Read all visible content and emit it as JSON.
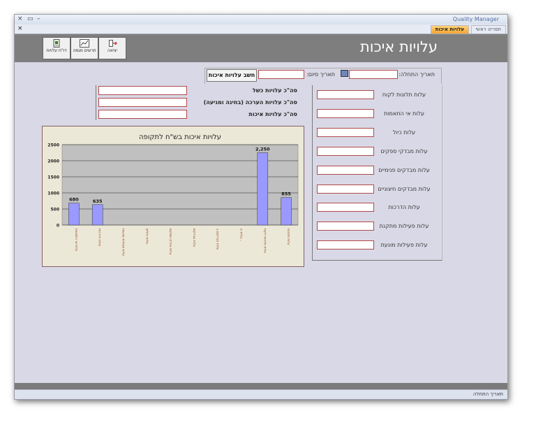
{
  "app": {
    "title": "Quality Manager",
    "window_controls": [
      "×",
      "▭",
      "–"
    ]
  },
  "tabs": [
    {
      "label": "עלויות איכות",
      "active": true
    },
    {
      "label": "תפריט ראשי",
      "active": false
    }
  ],
  "header": {
    "title": "עלויות איכות",
    "buttons": [
      {
        "label": "יציאה",
        "icon": "exit-icon"
      },
      {
        "label": "תרשים מגמה",
        "icon": "trend-chart-icon"
      },
      {
        "label": "דו\"ח עלויות",
        "icon": "report-icon"
      }
    ]
  },
  "filters": {
    "start_date_label": "תאריך התחלה:",
    "start_date_value": "",
    "end_date_label": "תאריך סיום:",
    "end_date_value": "",
    "calc_button": "חשב עלויות איכות"
  },
  "totals": [
    {
      "label": "סה\"כ עלויות כשל",
      "value": ""
    },
    {
      "label": "סה\"כ עלויות הערכה (בחינה ומניעה)",
      "value": ""
    },
    {
      "label": "סה\"כ עלויות איכות",
      "value": ""
    }
  ],
  "cost_fields": [
    {
      "label": "עלות תלונות לקוח",
      "value": ""
    },
    {
      "label": "עלות אי התאמות",
      "value": ""
    },
    {
      "label": "עלות כיול",
      "value": ""
    },
    {
      "label": "עלות מבדקי ספקים",
      "value": ""
    },
    {
      "label": "עלות מבדקים פנימיים",
      "value": ""
    },
    {
      "label": "עלות מבדקים חיצוניים",
      "value": ""
    },
    {
      "label": "עלות הדרכות",
      "value": ""
    },
    {
      "label": "עלות פעילות מתקנת",
      "value": ""
    },
    {
      "label": "עלות פעילות מונעת",
      "value": ""
    }
  ],
  "status": {
    "text": "תאריך התחלה"
  },
  "colors": {
    "bar": "#9999ff",
    "plot_bg": "#c0c0c0",
    "chart_bg": "#ece8d8",
    "tick_label": "#8a3a10"
  },
  "chart_data": {
    "type": "bar",
    "title": "עלויות איכות בש\"ח לתקופה",
    "categories": [
      "עלות אי התאמות",
      "עלות הדרכות",
      "עלות פעולות מונעות",
      "עלות כיולים",
      "עלות מבדקי ספקים",
      "עלות מבדקים",
      "עלות מבדקים ב",
      "עלות מ...",
      "עלות תלונות לקוח",
      "עלות תלונות"
    ],
    "values": [
      680,
      635,
      0,
      0,
      0,
      0,
      0,
      0,
      2250,
      855
    ],
    "value_labels": [
      "680",
      "635",
      "",
      "",
      "",
      "",
      "",
      "",
      "2,250",
      "855"
    ],
    "ylim": [
      0,
      2500
    ],
    "yticks": [
      "0",
      "500",
      "1000",
      "1500",
      "2000",
      "2500"
    ],
    "grid": true,
    "legend": "none"
  }
}
